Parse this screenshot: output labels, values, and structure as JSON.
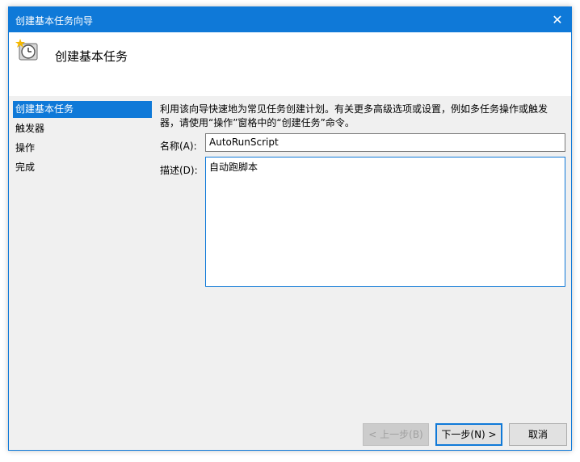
{
  "window": {
    "title": "创建基本任务向导",
    "close_glyph": "✕"
  },
  "header": {
    "title": "创建基本任务"
  },
  "sidebar": {
    "items": [
      {
        "label": "创建基本任务"
      },
      {
        "label": "触发器"
      },
      {
        "label": "操作"
      },
      {
        "label": "完成"
      }
    ]
  },
  "main": {
    "intro": "利用该向导快速地为常见任务创建计划。有关更多高级选项或设置，例如多任务操作或触发器，请使用“操作”窗格中的“创建任务”命令。",
    "name_label": "名称(A):",
    "name_value": "AutoRunScript",
    "desc_label": "描述(D):",
    "desc_value": "自动跑脚本"
  },
  "footer": {
    "back_label": "< 上一步(B)",
    "next_label": "下一步(N) >",
    "cancel_label": "取消"
  },
  "colors": {
    "accent": "#0f79d8"
  }
}
